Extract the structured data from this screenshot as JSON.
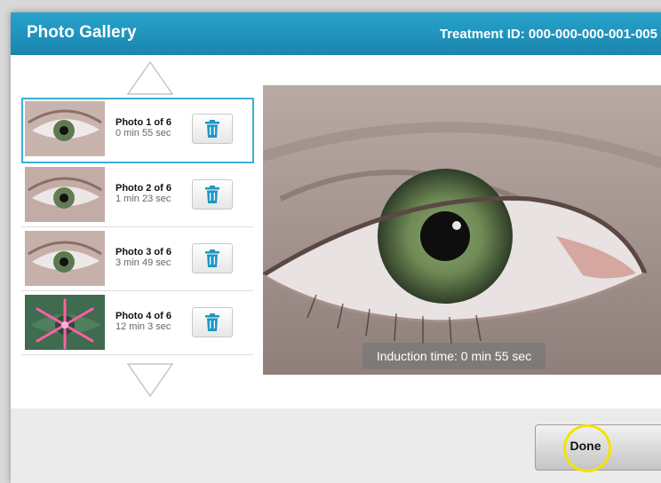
{
  "header": {
    "title": "Photo Gallery",
    "treatment_id": "Treatment ID:  000-000-000-001-005"
  },
  "photos": [
    {
      "title": "Photo 1 of 6",
      "time": "0 min 55 sec"
    },
    {
      "title": "Photo 2 of 6",
      "time": "1 min 23 sec"
    },
    {
      "title": "Photo 3 of 6",
      "time": "3 min 49 sec"
    },
    {
      "title": "Photo 4 of 6",
      "time": "12 min 3 sec"
    }
  ],
  "viewer": {
    "caption": "Induction time: 0 min 55 sec"
  },
  "footer": {
    "done_label": "Done"
  },
  "colors": {
    "header_blue": "#1a85ad",
    "selection_border": "#3bb0d6",
    "click_marker": "#f2e400"
  },
  "icons": {
    "scroll_up": "triangle-up-icon",
    "scroll_down": "triangle-down-icon",
    "delete": "trash-icon"
  }
}
